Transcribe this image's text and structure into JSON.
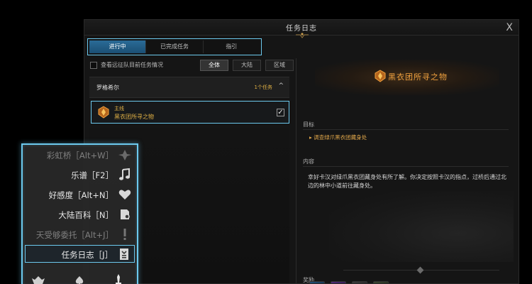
{
  "window": {
    "title": "任务日志",
    "close": "X",
    "tabs": [
      {
        "label": "进行中",
        "active": true
      },
      {
        "label": "已完成任务",
        "active": false
      },
      {
        "label": "指引",
        "active": false
      }
    ],
    "filter": {
      "checkbox_label": "查看远征队目前任务情况",
      "segments": [
        "全体",
        "大陆",
        "区域"
      ],
      "selected_segment": "全体"
    },
    "region": {
      "name": "罗格希尔",
      "count": "1个任务",
      "chevron": "^"
    },
    "quest": {
      "type": "主线",
      "name": "黑衣团所寻之物",
      "checked": true
    },
    "detail": {
      "title": "黑衣团所寻之物",
      "goal_label": "目标",
      "goal_text": "▸ 调查绿爪黑衣团藏身处",
      "content_label": "内容",
      "content_text": "幸好卡汉对绿爪黑衣团藏身处有所了解。你决定按照卡汉的指点，过桥后通过北边的林中小道前往藏身处。",
      "reward_label": "奖励"
    },
    "colors": {
      "accent_blue": "#6cc9ee",
      "quest_gold": "#e1b145",
      "title_orange": "#f0a13e"
    }
  },
  "menu": {
    "items": [
      {
        "label": "彩虹桥［Alt+W］",
        "icon": "rainbow-bridge-icon",
        "faded": true
      },
      {
        "label": "乐谱［F2］",
        "icon": "music-note-icon",
        "faded": false
      },
      {
        "label": "好感度［Alt+N］",
        "icon": "heart-icon",
        "faded": false
      },
      {
        "label": "大陆百科［N］",
        "icon": "encyclopedia-icon",
        "faded": false
      },
      {
        "label": "天受够委托［Alt+J］",
        "icon": "exclamation-icon",
        "faded": true
      },
      {
        "label": "任务日志［J］",
        "icon": "quest-log-icon",
        "faded": false,
        "selected": true
      }
    ]
  }
}
